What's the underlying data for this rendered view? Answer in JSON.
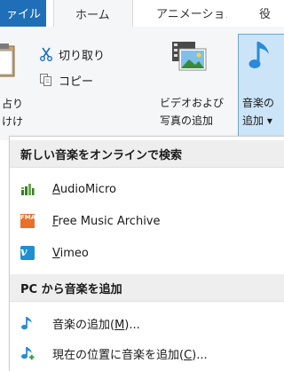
{
  "ribbon_tabs": {
    "file": "ァイル",
    "home": "ホーム",
    "animations": "アニメーション",
    "more": "役"
  },
  "clipboard": {
    "paste_label_line1": "占り",
    "paste_label_line2": "けけ",
    "cut_label": "切り取り",
    "copy_label": "コピー"
  },
  "video_button": {
    "label_line1": "ビデオおよび",
    "label_line2": "写真の追加"
  },
  "music_button": {
    "label_line1": "音楽の",
    "label_line2": "追加 ▾"
  },
  "menu": {
    "online_header": "新しい音楽をオンラインで検索",
    "online_items": [
      {
        "prefix": "",
        "mnemonic": "A",
        "rest": "udioMicro"
      },
      {
        "prefix": "",
        "mnemonic": "F",
        "rest": "ree Music Archive"
      },
      {
        "prefix": "",
        "mnemonic": "V",
        "rest": "imeo"
      }
    ],
    "pc_header": "PC から音楽を追加",
    "pc_items": [
      {
        "prefix": "音楽の追加(",
        "mnemonic": "M",
        "rest": ")..."
      },
      {
        "prefix": "現在の位置に音楽を追加(",
        "mnemonic": "C",
        "rest": ")..."
      }
    ],
    "fma_badge_text": "FMA",
    "vimeo_badge_text": "v"
  },
  "icons": {
    "paste": "paste-icon",
    "cut": "scissors-icon",
    "copy": "copy-icon",
    "video": "photo-video-icon",
    "music": "music-note-icon",
    "audiomicro": "audiomicro-logo-icon",
    "fma": "fma-logo-icon",
    "vimeo": "vimeo-logo-icon",
    "add_music": "music-note-icon",
    "add_music_at_position": "music-note-add-icon"
  },
  "colors": {
    "file_tab": "#1e6fb8",
    "ribbon_bg": "#f5f6f7",
    "music_button_bg": "#cce4f7",
    "music_button_border": "#6aa6d8",
    "menu_header_bg": "#eeeeee",
    "note_blue": "#2a8ad8",
    "fma_orange": "#e8702a",
    "vimeo_blue": "#1f8fd0",
    "audiomicro_green": "#3a7d2c"
  }
}
